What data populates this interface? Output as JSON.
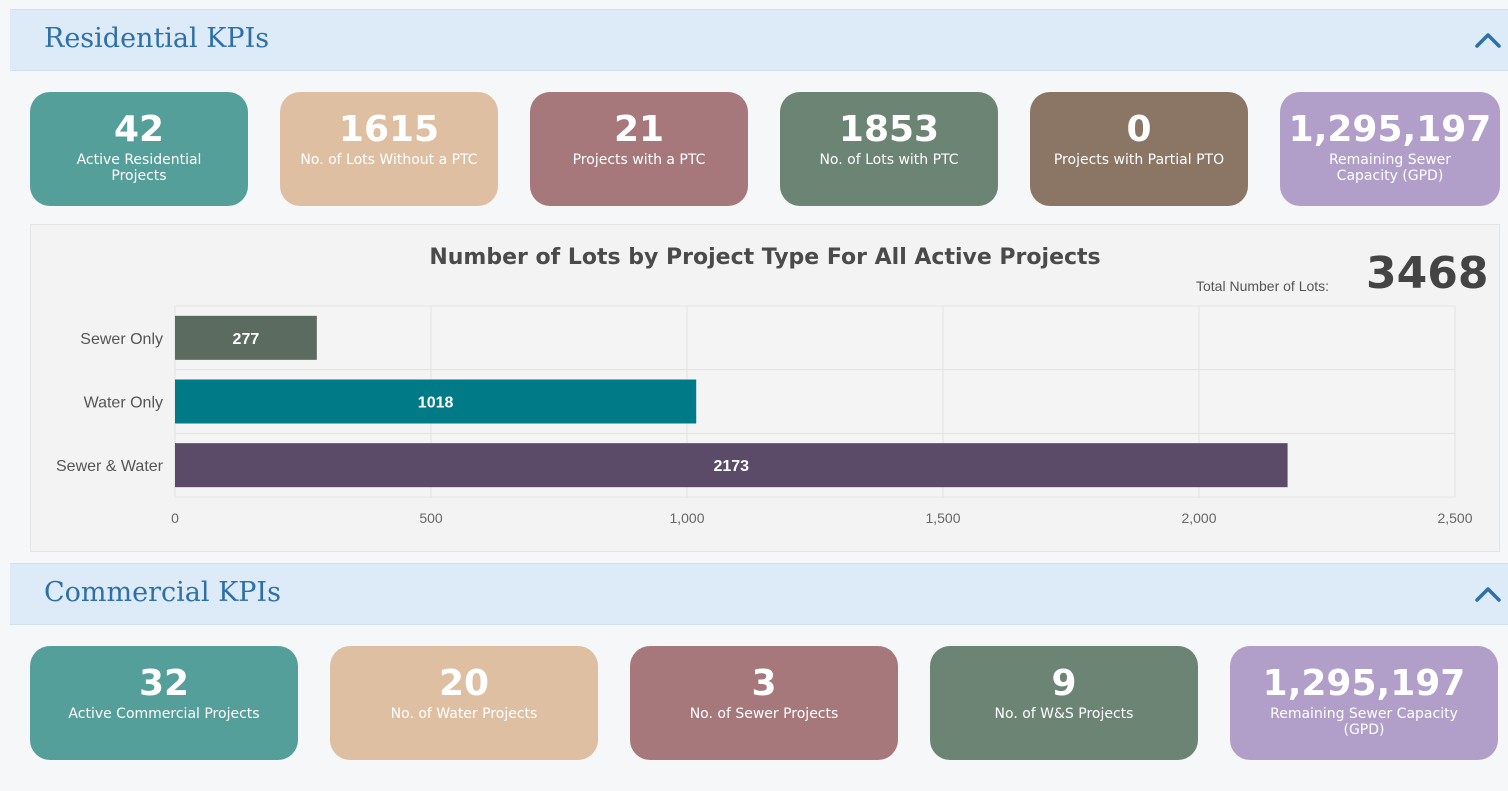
{
  "residential": {
    "title": "Residential KPIs",
    "kpis": [
      {
        "value": "42",
        "label": "Active Residential Projects",
        "color": "#559f9a"
      },
      {
        "value": "1615",
        "label": "No. of Lots Without a PTC",
        "color": "#dfbfa2"
      },
      {
        "value": "21",
        "label": "Projects with a PTC",
        "color": "#a6787c"
      },
      {
        "value": "1853",
        "label": "No. of Lots with PTC",
        "color": "#6b8474"
      },
      {
        "value": "0",
        "label": "Projects with Partial PTO",
        "color": "#8b7564"
      },
      {
        "value": "1,295,197",
        "label": "Remaining Sewer Capacity (GPD)",
        "color": "#b19ec9"
      }
    ]
  },
  "chart": {
    "total_label": "Total Number of Lots:",
    "total_value": "3468"
  },
  "chart_data": {
    "type": "bar",
    "orientation": "horizontal",
    "title": "Number of Lots by Project Type For All Active Projects",
    "categories": [
      "Sewer Only",
      "Water Only",
      "Sewer & Water"
    ],
    "values": [
      277,
      1018,
      2173
    ],
    "colors": [
      "#5b6b5f",
      "#007a87",
      "#5b4a68"
    ],
    "xlim": [
      0,
      2500
    ],
    "xticks": [
      "0",
      "500",
      "1,000",
      "1,500",
      "2,000",
      "2,500"
    ],
    "grid": true
  },
  "commercial": {
    "title": "Commercial KPIs",
    "kpis": [
      {
        "value": "32",
        "label": "Active Commercial Projects",
        "color": "#559f9a"
      },
      {
        "value": "20",
        "label": "No. of Water Projects",
        "color": "#dfbfa2"
      },
      {
        "value": "3",
        "label": "No. of Sewer Projects",
        "color": "#a6787c"
      },
      {
        "value": "9",
        "label": "No. of W&S Projects",
        "color": "#6b8474"
      },
      {
        "value": "1,295,197",
        "label": "Remaining Sewer Capacity (GPD)",
        "color": "#b19ec9"
      }
    ]
  },
  "icons": {
    "collapse": "chevron-up-icon"
  }
}
